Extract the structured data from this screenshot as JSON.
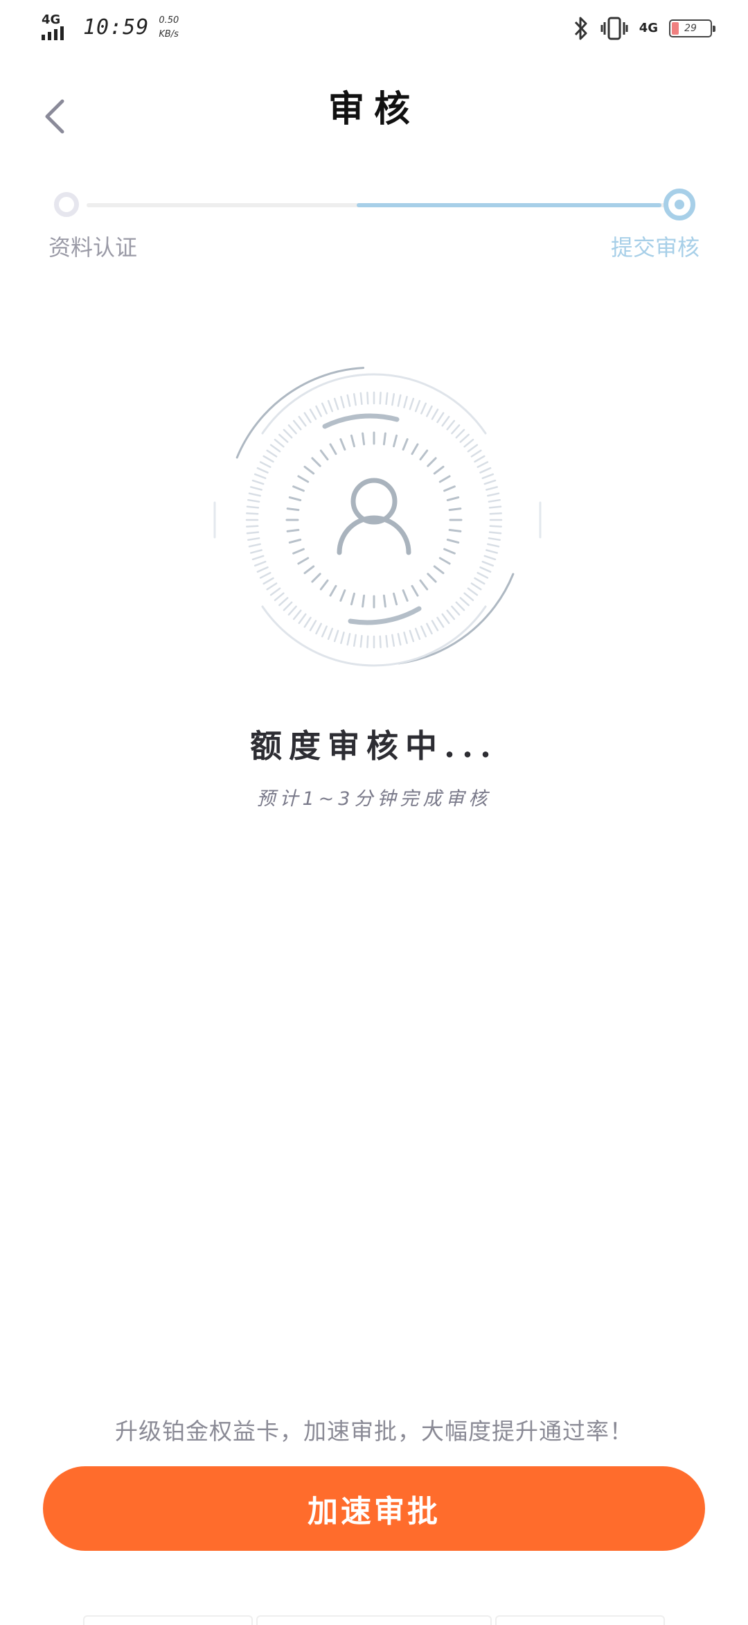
{
  "status_bar": {
    "network_left": "4G",
    "time": "10:59",
    "speed_value": "0.50",
    "speed_unit": "KB/s",
    "network_right": "4G",
    "battery": "29",
    "icons": [
      "signal-icon",
      "bluetooth-icon",
      "vibrate-icon",
      "battery-icon"
    ]
  },
  "header": {
    "title": "审核",
    "back_icon": "chevron-left-icon"
  },
  "steps": [
    {
      "label": "资料认证",
      "active": false
    },
    {
      "label": "提交审核",
      "active": true
    }
  ],
  "review": {
    "icon": "user-icon",
    "title": "额度审核中...",
    "subtitle": "预计1~3分钟完成审核"
  },
  "promo_text": "升级铂金权益卡，加速审批，大幅度提升通过率！",
  "cta_label": "加速审批",
  "colors": {
    "accent_orange": "#ff6c2c",
    "step_active": "#a7cfe8",
    "graphic_gray": "#a9b3bd"
  }
}
